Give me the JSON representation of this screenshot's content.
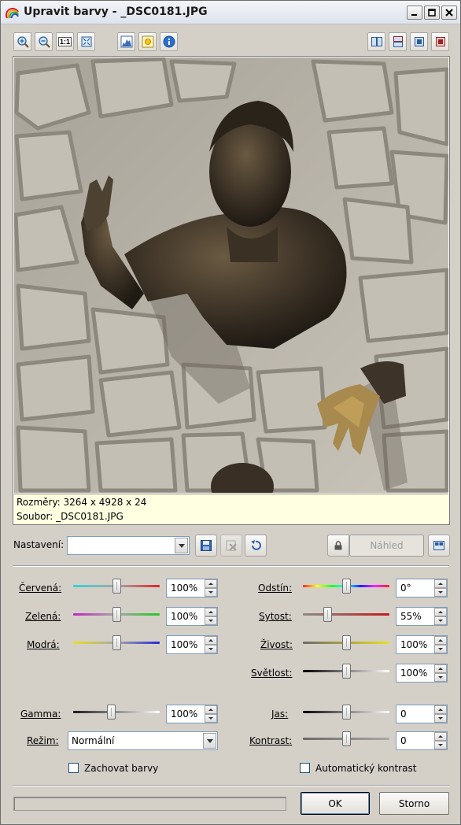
{
  "window": {
    "title": "Upravit barvy - _DSC0181.JPG"
  },
  "toolbar": {
    "left_icons": [
      "zoom-in-icon",
      "zoom-out-icon",
      "actual-size-icon",
      "fit-to-window-icon",
      "histogram-icon",
      "auto-enhance-icon",
      "info-icon"
    ],
    "actual_size_label": "1:1",
    "right_icons": [
      "split-vertical-icon",
      "split-horizontal-icon",
      "single-view-icon",
      "original-view-icon"
    ]
  },
  "info": {
    "dimensions": "Rozměry: 3264 x 4928 x 24",
    "file": "Soubor: _DSC0181.JPG"
  },
  "settings": {
    "label": "Nastavení:",
    "value": "",
    "preview_label": "Náhled"
  },
  "left_controls": [
    {
      "label": "Červená:",
      "value": "100%",
      "level": 0.5
    },
    {
      "label": "Zelená:",
      "value": "100%",
      "level": 0.5
    },
    {
      "label": "Modrá:",
      "value": "100%",
      "level": 0.5
    }
  ],
  "right_controls": [
    {
      "label": "Odstín:",
      "value": "0°",
      "level": 0.5
    },
    {
      "label": "Sytost:",
      "value": "55%",
      "level": 0.28
    },
    {
      "label": "Živost:",
      "value": "100%",
      "level": 0.5
    },
    {
      "label": "Světlost:",
      "value": "100%",
      "level": 0.5
    }
  ],
  "gamma": {
    "label": "Gamma:",
    "value": "100%",
    "level": 0.45
  },
  "mode": {
    "label": "Režim:",
    "value": "Normální"
  },
  "brightness": {
    "label": "Jas:",
    "value": "0",
    "level": 0.5
  },
  "contrast": {
    "label": "Kontrast:",
    "value": "0",
    "level": 0.5
  },
  "checkboxes": {
    "keep_colors": {
      "label": "Zachovat barvy",
      "checked": false
    },
    "auto_contrast": {
      "label": "Automatický kontrast",
      "checked": false
    }
  },
  "buttons": {
    "ok": "OK",
    "cancel": "Storno"
  }
}
